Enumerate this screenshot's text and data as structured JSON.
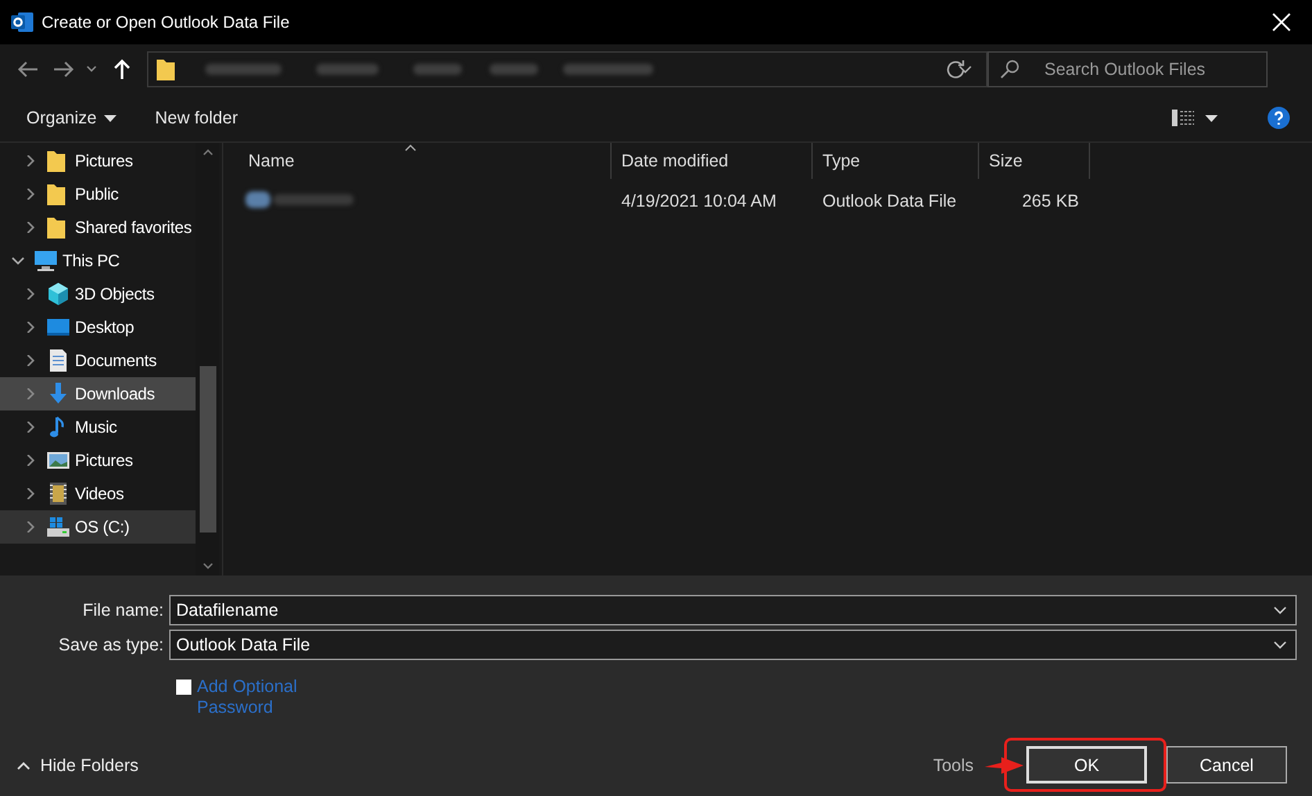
{
  "window": {
    "title": "Create or Open Outlook Data File"
  },
  "search": {
    "placeholder": "Search Outlook Files"
  },
  "toolbar": {
    "buttons": [
      {
        "label": "Organize",
        "dropdown": true
      },
      {
        "label": "New folder",
        "dropdown": false
      }
    ]
  },
  "sidebar": {
    "items": [
      {
        "children": [
          {
            "label": "Pictures",
            "kind": "folder",
            "selected": false,
            "hovered": false
          },
          {
            "label": "Public",
            "kind": "folder",
            "selected": false,
            "hovered": false
          },
          {
            "label": "Shared favorites",
            "kind": "folder",
            "selected": false,
            "hovered": false
          }
        ]
      },
      {
        "label": "This PC",
        "kind": "pc",
        "expanded": true,
        "selected": false,
        "hovered": false,
        "children": [
          {
            "label": "3D Objects",
            "kind": "cube",
            "selected": false,
            "hovered": false
          },
          {
            "label": "Desktop",
            "kind": "desktop",
            "selected": false,
            "hovered": false
          },
          {
            "label": "Documents",
            "kind": "documents",
            "selected": false,
            "hovered": false
          },
          {
            "label": "Downloads",
            "kind": "download",
            "selected": true,
            "hovered": false
          },
          {
            "label": "Music",
            "kind": "music",
            "selected": false,
            "hovered": false
          },
          {
            "label": "Pictures",
            "kind": "pictures",
            "selected": false,
            "hovered": false
          },
          {
            "label": "Videos",
            "kind": "videos",
            "selected": false,
            "hovered": false
          },
          {
            "label": "OS (C:)",
            "kind": "drive",
            "selected": false,
            "hovered": true
          }
        ]
      }
    ]
  },
  "table": {
    "columns": [
      {
        "label": "Name",
        "sorted": true
      },
      {
        "label": "Date modified",
        "sorted": false
      },
      {
        "label": "Type",
        "sorted": false
      },
      {
        "label": "Size",
        "sorted": false
      }
    ],
    "rows": [
      {
        "date_modified": "4/19/2021 10:04 AM",
        "type": "Outlook Data File",
        "size": "265 KB"
      }
    ]
  },
  "form": {
    "fields": [
      {
        "label": "File name:",
        "value": "Datafilename"
      },
      {
        "label": "Save as type:",
        "value": "Outlook Data File"
      }
    ],
    "password_option": {
      "label": "Add Optional Password",
      "checked": false
    }
  },
  "footer": {
    "hide_folders": "Hide Folders",
    "tools": "Tools",
    "buttons": [
      {
        "label": "OK",
        "highlighted": true
      },
      {
        "label": "Cancel",
        "highlighted": false
      }
    ]
  }
}
